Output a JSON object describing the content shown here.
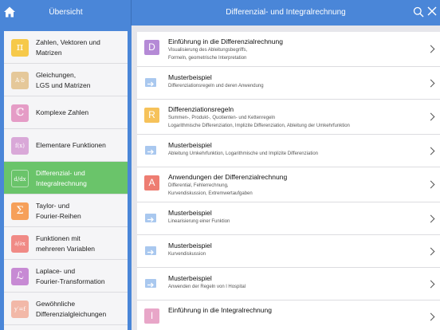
{
  "header": {
    "left_title": "Übersicht",
    "right_title": "Differenzial- und Integralrechnung",
    "home_icon": "home-icon",
    "search_icon": "search-icon",
    "close_icon": "close-icon"
  },
  "sidebar": {
    "items": [
      {
        "label": "Zahlen, Vektoren und\nMatrizen",
        "icon": "π",
        "color": "#f6c94a"
      },
      {
        "label": "Gleichungen,\nLGS und Matrizen",
        "icon": "A·b",
        "color": "#e5c89a"
      },
      {
        "label": "Komplexe Zahlen",
        "icon": "ℂ",
        "color": "#e59cc6"
      },
      {
        "label": "Elementare Funktionen",
        "icon": "f(x)",
        "color": "#d9a8d8"
      },
      {
        "label": "Differenzial- und\nIntegralrechnung",
        "icon": "d/dx",
        "color": "#6ac46a",
        "active": true
      },
      {
        "label": "Taylor- und\nFourier-Reihen",
        "icon": "Σ",
        "color": "#f6a05a"
      },
      {
        "label": "Funktionen mit\nmehreren Variablen",
        "icon": "∂/∂x",
        "color": "#f08a86"
      },
      {
        "label": "Laplace- und\nFourier-Transformation",
        "icon": "ℒ",
        "color": "#c78ad4"
      },
      {
        "label": "Gewöhnliche\nDifferenzialgleichungen",
        "icon": "y′=f",
        "color": "#f2b8a8"
      }
    ]
  },
  "main": {
    "rows": [
      {
        "badge": "D",
        "badge_color": "#b58ad6",
        "title": "Einführung in die Differenzialrechnung",
        "sub": "Visualisierung des Ableitungsbegriffs,\nFormeln, geometrische Interpretation"
      },
      {
        "arrow": true,
        "title": "Musterbeispiel",
        "sub": "Differenziationsregeln und deren Anwendung"
      },
      {
        "badge": "R",
        "badge_color": "#f6c25a",
        "title": "Differenziationsregeln",
        "sub": "Summen-, Produkt-, Quotienten- und Kettenregeln\nLogarithmische Differenziation, Implizite Differenziation, Ableitung der Umkehrfunktion"
      },
      {
        "arrow": true,
        "title": "Musterbeispiel",
        "sub": "Ableitung Umkehrfunktion, Logarithmische und Implizite Differenziation"
      },
      {
        "badge": "A",
        "badge_color": "#ee7d72",
        "title": "Anwendungen der Differenzialrechnung",
        "sub": "Differential, Fehlerrechnung,\nKurvendiskussion, Extremwertaufgaben"
      },
      {
        "arrow": true,
        "title": "Musterbeispiel",
        "sub": "Linearisierung einer Funktion"
      },
      {
        "arrow": true,
        "title": "Musterbeispiel",
        "sub": "Kurvendiskussion"
      },
      {
        "arrow": true,
        "title": "Musterbeispiel",
        "sub": "Anwenden der Regeln von l Hospital"
      },
      {
        "badge": "I",
        "badge_color": "#e8a6c8",
        "title": "Einführung in die Integralrechnung",
        "sub": ""
      }
    ]
  }
}
